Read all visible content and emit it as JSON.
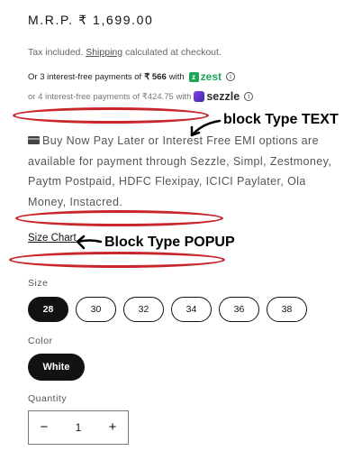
{
  "product": {
    "price": "M.R.P. ₹ 1,699.00",
    "tax_prefix": "Tax included.",
    "tax_link": "Shipping",
    "tax_suffix": "calculated at checkout."
  },
  "zest": {
    "prefix": "Or 3 interest-free payments of",
    "amount": "₹ 566",
    "with": "with",
    "brand": "zest",
    "info": "i"
  },
  "sezzle": {
    "text": "or 4 interest-free payments of ₹424.75 with",
    "brand": "sezzle",
    "info": "i"
  },
  "bnpl": {
    "text": "Buy Now Pay Later or Interest Free EMI options are available for payment through Sezzle, Simpl, Zestmoney, Paytm Postpaid, HDFC Flexipay, ICICI Paylater, Ola Money, Instacred."
  },
  "size_chart": {
    "label": "Size Chart"
  },
  "annotations": {
    "text_block": "block Type TEXT",
    "popup_block": "Block Type POPUP"
  },
  "size": {
    "label": "Size",
    "options": [
      "28",
      "30",
      "32",
      "34",
      "36",
      "38"
    ],
    "selected": "28"
  },
  "color": {
    "label": "Color",
    "options": [
      "White"
    ],
    "selected": "White"
  },
  "quantity": {
    "label": "Quantity",
    "value": "1",
    "minus": "−",
    "plus": "+"
  },
  "colors": {
    "annotation_red": "#c9262c",
    "selected_bg": "#121212",
    "zest_green": "#1ea55a",
    "sezzle_purple": "#8a3cf5"
  },
  "icons": [
    "card-icon",
    "info-icon",
    "zest-logo-icon",
    "sezzle-logo-icon",
    "arrow-icon"
  ]
}
